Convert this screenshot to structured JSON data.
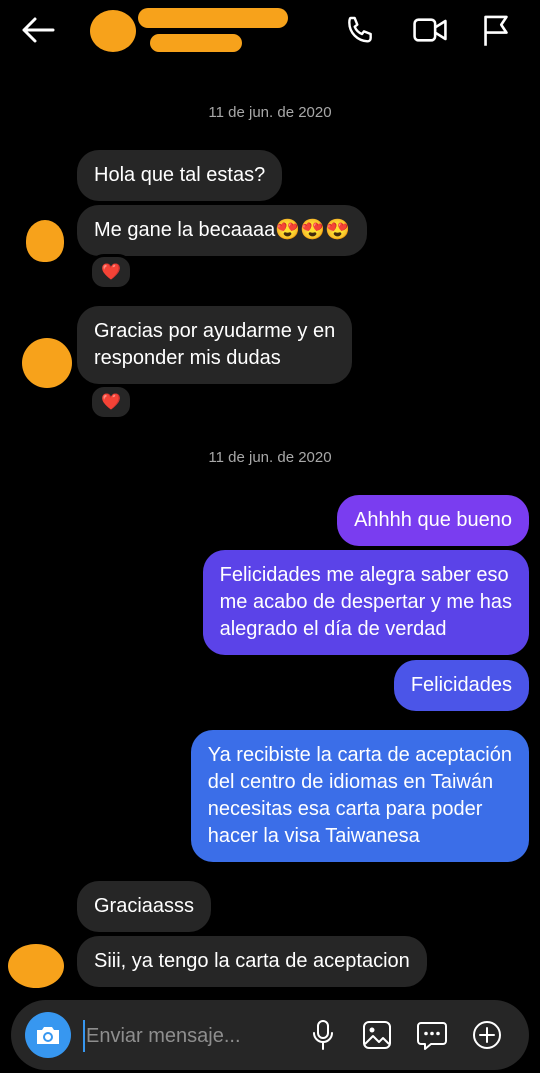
{
  "header": {
    "back_icon": "arrow-left-icon",
    "call_icon": "phone-icon",
    "video_icon": "video-camera-icon",
    "report_icon": "flag-icon"
  },
  "thread": {
    "date_1": "11 de jun. de 2020",
    "date_2": "11 de jun. de 2020",
    "messages": [
      {
        "dir": "in",
        "text": "Hola que tal estas?"
      },
      {
        "dir": "in",
        "text": "Me gane la becaaaa😍😍😍",
        "reaction": "❤️"
      },
      {
        "dir": "in",
        "text": "Gracias por ayudarme y en\nresponder mis dudas",
        "reaction": "❤️"
      },
      {
        "dir": "out",
        "text": "Ahhhh que bueno"
      },
      {
        "dir": "out",
        "text": "Felicidades me alegra saber eso\nme acabo de despertar y me has\nalegrado el día de verdad"
      },
      {
        "dir": "out",
        "text": "Felicidades"
      },
      {
        "dir": "out",
        "text": "Ya recibiste la carta de aceptación\ndel centro de idiomas en Taiwán\nnecesitas esa carta para poder\nhacer la visa Taiwanesa"
      },
      {
        "dir": "in",
        "text": "Graciaasss"
      },
      {
        "dir": "in",
        "text": "Siii, ya tengo la carta de aceptacion"
      }
    ]
  },
  "composer": {
    "placeholder": "Enviar mensaje...",
    "camera_icon": "camera-icon",
    "mic_icon": "microphone-icon",
    "gallery_icon": "image-icon",
    "sticker_icon": "sticker-chat-icon",
    "plus_icon": "plus-circle-icon"
  },
  "colors": {
    "background": "#000000",
    "incoming_bubble": "#262626",
    "outgoing_purple": "#7a3df0",
    "outgoing_blue": "#3b6ee8",
    "accent": "#3797f0",
    "reaction_heart": "#e0245e"
  }
}
